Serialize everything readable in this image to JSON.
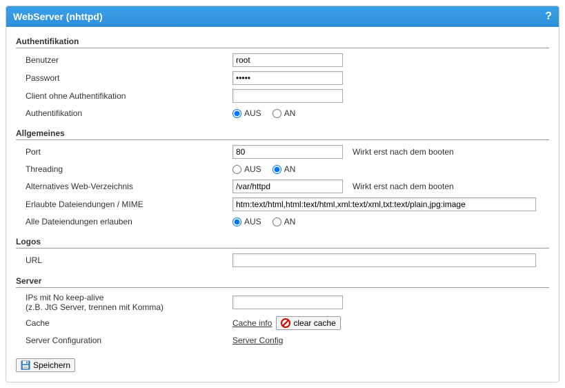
{
  "header": {
    "title": "WebServer (nhttpd)",
    "help": "?"
  },
  "sections": {
    "auth": {
      "title": "Authentifikation",
      "user_label": "Benutzer",
      "user_value": "root",
      "pass_label": "Passwort",
      "pass_value": "•••••",
      "client_noauth_label": "Client ohne Authentifikation",
      "client_noauth_value": "",
      "auth_label": "Authentifikation",
      "aus": "AUS",
      "an": "AN"
    },
    "general": {
      "title": "Allgemeines",
      "port_label": "Port",
      "port_value": "80",
      "port_hint": "Wirkt erst nach dem booten",
      "threading_label": "Threading",
      "aus": "AUS",
      "an": "AN",
      "altdir_label": "Alternatives Web-Verzeichnis",
      "altdir_value": "/var/httpd",
      "altdir_hint": "Wirkt erst nach dem booten",
      "mime_label": "Erlaubte Dateiendungen / MIME",
      "mime_value": "htm:text/html,html:text/html,xml:text/xml,txt:text/plain,jpg:image",
      "allext_label": "Alle Dateiendungen erlauben"
    },
    "logos": {
      "title": "Logos",
      "url_label": "URL",
      "url_value": ""
    },
    "server": {
      "title": "Server",
      "nokeep_label": "IPs mit No keep-alive",
      "nokeep_sub": "(z.B. JtG Server, trennen mit Komma)",
      "nokeep_value": "",
      "cache_label": "Cache",
      "cache_info": "Cache info",
      "clear_cache": "clear cache",
      "config_label": "Server Configuration",
      "config_link": "Server Config"
    }
  },
  "footer": {
    "save": "Speichern"
  }
}
